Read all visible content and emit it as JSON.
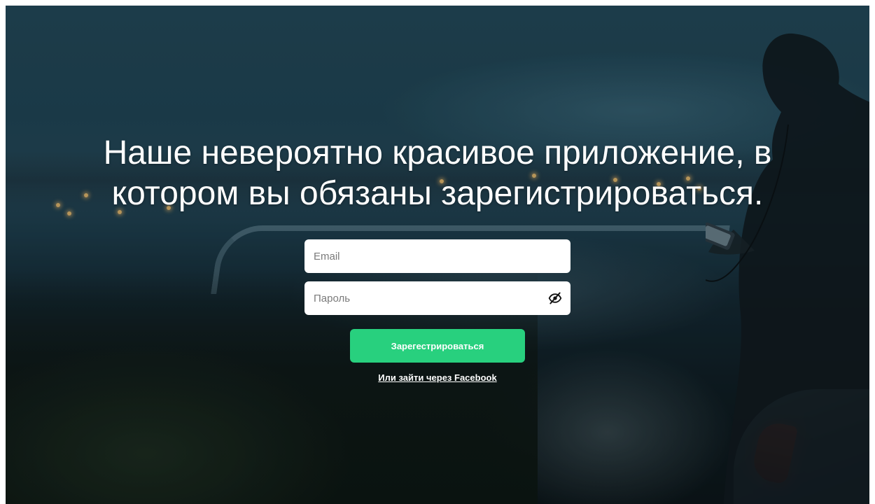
{
  "hero": {
    "headline": "Наше невероятно красивое приложение, в котором вы обязаны зарегистрироваться."
  },
  "form": {
    "email": {
      "placeholder": "Email",
      "value": ""
    },
    "password": {
      "placeholder": "Пароль",
      "value": "",
      "toggle_icon": "eye-off-icon"
    },
    "submit_label": "Зарегестрироваться",
    "facebook_link": "Или зайти через Facebook"
  },
  "colors": {
    "accent": "#28d07e",
    "text_on_dark": "#ffffff",
    "field_bg": "#ffffff"
  }
}
